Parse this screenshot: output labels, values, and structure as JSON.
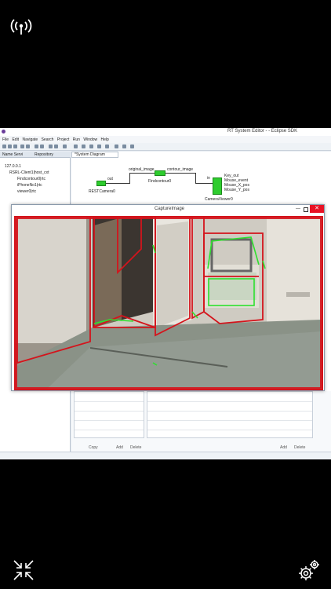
{
  "window": {
    "title": "RT System Editor - - Eclipse SDK"
  },
  "menu": [
    "File",
    "Edit",
    "Navigate",
    "Search",
    "Project",
    "Run",
    "Window",
    "Help"
  ],
  "left_panel": {
    "tabs": [
      "Name Servi",
      "Repository"
    ],
    "tree": [
      {
        "label": "127.0.0.1",
        "indent": 0
      },
      {
        "label": "RSRL-Client1|host_cxt",
        "indent": 1
      },
      {
        "label": "Findcontour0|rtc",
        "indent": 2
      },
      {
        "label": "iPhoneNo1|rtc",
        "indent": 2
      },
      {
        "label": "viewer0|rtc",
        "indent": 2
      }
    ]
  },
  "diagram": {
    "tab_label": "*System Diagram",
    "ports": {
      "out": "out",
      "original_image": "original_image",
      "contour_image": "contour_image",
      "in": "in",
      "key_out": "Key_out",
      "mouse_event": "Mouse_event",
      "mouse_x": "Mouse_X_pos",
      "mouse_y": "Mouse_Y_pos"
    },
    "components": {
      "camera": "RESTCamera0",
      "findcontour": "Findcontour0",
      "viewer": "CameraViewer0"
    }
  },
  "capture_window": {
    "title": "CaptureImage",
    "close_glyph": "✕",
    "min_glyph": "—"
  },
  "props": {
    "copy": "Copy",
    "add": "Add",
    "delete": "Delete"
  },
  "icons": {
    "top_left": "signal-icon",
    "bottom_left": "collapse-icon",
    "bottom_right": "settings-icon"
  },
  "colors": {
    "accent": "#2ecc2e",
    "contour": "#d4141c",
    "close": "#e81123"
  }
}
